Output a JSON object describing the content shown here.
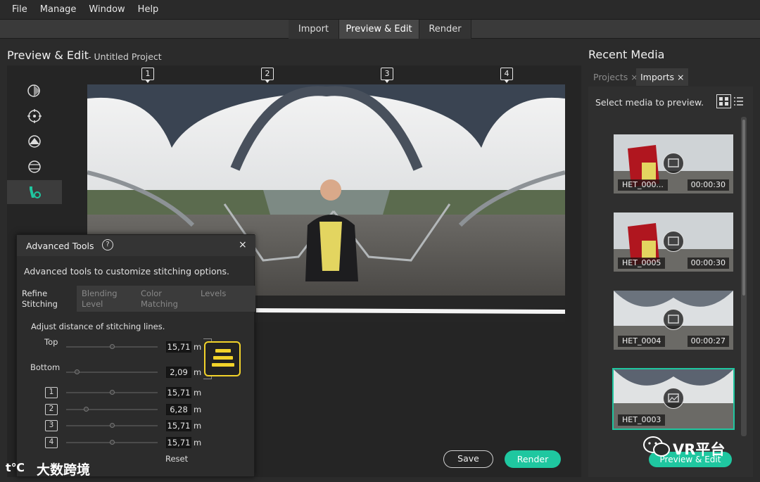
{
  "menu": [
    "File",
    "Manage",
    "Window",
    "Help"
  ],
  "tabs": [
    {
      "label": "Import",
      "active": false
    },
    {
      "label": "Preview & Edit",
      "active": true
    },
    {
      "label": "Render",
      "active": false
    }
  ],
  "editor": {
    "title": "Preview & Edit",
    "subtitle": "- Untitled Project",
    "markers": [
      "1",
      "2",
      "3",
      "4"
    ]
  },
  "advanced_tools": {
    "title": "Advanced Tools",
    "help": "?",
    "close": "×",
    "description": "Advanced tools to customize stitching options.",
    "tabs": [
      {
        "label": "Refine Stitching",
        "active": true
      },
      {
        "label": "Blending Level",
        "active": false
      },
      {
        "label": "Color Matching",
        "active": false
      },
      {
        "label": "Levels",
        "active": false
      }
    ],
    "instruction": "Adjust distance of stitching lines.",
    "rows": [
      {
        "label": "Top",
        "value": "15,71",
        "unit": "m",
        "knob": 0.5
      },
      {
        "label": "Bottom",
        "value": "2,09",
        "unit": "m",
        "knob": 0.1
      },
      {
        "label": "1",
        "value": "15,71",
        "unit": "m",
        "knob": 0.5
      },
      {
        "label": "2",
        "value": "6,28",
        "unit": "m",
        "knob": 0.2
      },
      {
        "label": "3",
        "value": "15,71",
        "unit": "m",
        "knob": 0.5
      },
      {
        "label": "4",
        "value": "15,71",
        "unit": "m",
        "knob": 0.5
      }
    ],
    "reset": "Reset"
  },
  "actions": {
    "save": "Save",
    "render": "Render"
  },
  "recent_media": {
    "title": "Recent Media",
    "tabs": [
      {
        "label": "Projects",
        "close": "×",
        "active": false
      },
      {
        "label": "Imports",
        "close": "×",
        "active": true
      }
    ],
    "hint": "Select media to preview.",
    "items": [
      {
        "name": "HET_000...",
        "duration": "00:00:30",
        "type": "video"
      },
      {
        "name": "HET_0005",
        "duration": "00:00:30",
        "type": "video"
      },
      {
        "name": "HET_0004",
        "duration": "00:00:27",
        "type": "video"
      },
      {
        "name": "HET_0003",
        "duration": "",
        "type": "image",
        "selected": true
      }
    ],
    "button": "Preview & Edit"
  },
  "watermark": {
    "left": "大数跨境",
    "right": "VR平台"
  },
  "colors": {
    "accent": "#1fc7a0",
    "highlight": "#f2d32a",
    "background": "#2b2b2b"
  }
}
